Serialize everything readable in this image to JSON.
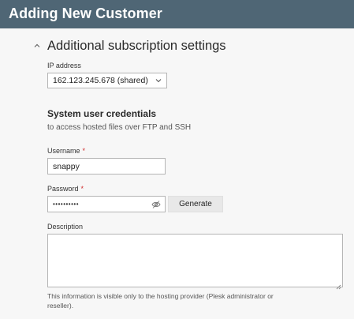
{
  "header": {
    "title": "Adding New Customer"
  },
  "section": {
    "title": "Additional subscription settings",
    "toggle_icon": "chevron-up-icon"
  },
  "ip": {
    "label": "IP address",
    "selected": "162.123.245.678 (shared)",
    "icon": "chevron-down-icon"
  },
  "credentials": {
    "heading": "System user credentials",
    "note": "to access hosted files over FTP and SSH"
  },
  "username": {
    "label": "Username",
    "required_mark": "*",
    "value": "snappy"
  },
  "password": {
    "label": "Password",
    "required_mark": "*",
    "value": "••••••••••",
    "visibility_icon": "eye-slash-icon",
    "generate_label": "Generate"
  },
  "description": {
    "label": "Description",
    "value": "",
    "help": "This information is visible only to the hosting provider (Plesk administrator or reseller)."
  }
}
